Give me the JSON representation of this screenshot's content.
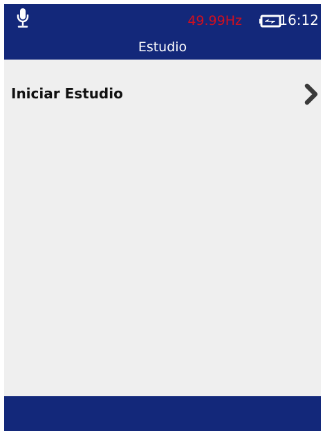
{
  "status_bar": {
    "mic_icon": "microphone-icon",
    "frequency": "49.99Hz",
    "frequency_color": "#d10f1f",
    "battery_icon": "battery-charging-icon",
    "time": "16:12"
  },
  "header": {
    "title": "Estudio",
    "background_color": "#13287a"
  },
  "menu": {
    "items": [
      {
        "label": "Iniciar Estudio",
        "icon": "chevron-right-icon"
      }
    ]
  },
  "footer": {
    "background_color": "#13287a"
  }
}
